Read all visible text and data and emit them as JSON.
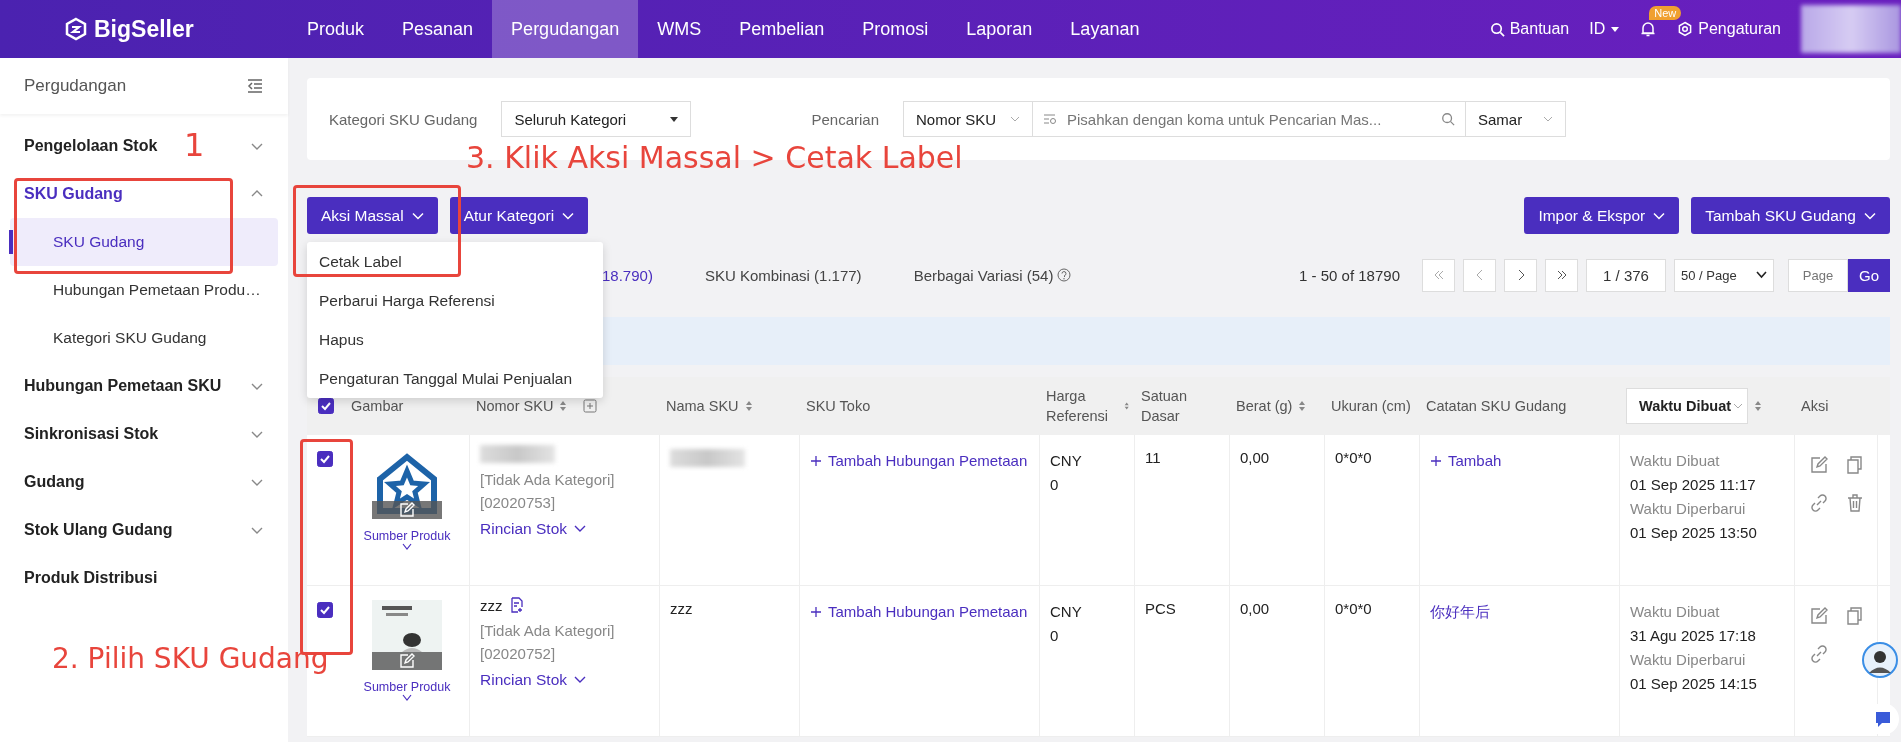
{
  "topbar": {
    "logo": "BigSeller",
    "nav": [
      {
        "label": "Produk",
        "selected": false
      },
      {
        "label": "Pesanan",
        "selected": false
      },
      {
        "label": "Pergudangan",
        "selected": true
      },
      {
        "label": "WMS",
        "selected": false
      },
      {
        "label": "Pembelian",
        "selected": false
      },
      {
        "label": "Promosi",
        "selected": false
      },
      {
        "label": "Laporan",
        "selected": false
      },
      {
        "label": "Layanan",
        "selected": false
      }
    ],
    "help": "Bantuan",
    "language": "ID",
    "badge": "New",
    "settings": "Pengaturan"
  },
  "sidebar": {
    "title": "Pergudangan",
    "items": [
      {
        "label": "Pengelolaan Stok",
        "kind": "group",
        "selected": false,
        "expanded": false
      },
      {
        "label": "SKU Gudang",
        "kind": "group",
        "selected": true,
        "expanded": true,
        "children": [
          {
            "label": "SKU Gudang",
            "selected": true
          },
          {
            "label": "Hubungan Pemetaan Produ…",
            "selected": false
          },
          {
            "label": "Kategori SKU Gudang",
            "selected": false
          }
        ]
      },
      {
        "label": "Hubungan Pemetaan SKU",
        "kind": "group",
        "selected": false,
        "expanded": false
      },
      {
        "label": "Sinkronisasi Stok",
        "kind": "group",
        "selected": false,
        "expanded": false
      },
      {
        "label": "Gudang",
        "kind": "group",
        "selected": false,
        "expanded": false
      },
      {
        "label": "Stok Ulang Gudang",
        "kind": "group",
        "selected": false,
        "expanded": false
      },
      {
        "label": "Produk Distribusi",
        "kind": "link",
        "selected": false
      }
    ]
  },
  "filters": {
    "category_label": "Kategori SKU Gudang",
    "category_value": "Seluruh Kategori",
    "search_label": "Pencarian",
    "search_type": "Nomor SKU",
    "search_placeholder": "Pisahkan dengan koma untuk Pencarian Mas...",
    "match_mode": "Samar"
  },
  "toolbar": {
    "left_buttons": [
      "Aksi Massal",
      "Atur Kategori"
    ],
    "right_buttons": [
      "Impor & Ekspor",
      "Tambah SKU Gudang"
    ]
  },
  "bulk_menu": {
    "items": [
      "Cetak Label",
      "Perbarui Harga Referensi",
      "Hapus",
      "Pengaturan Tanggal Mulai Penjualan"
    ]
  },
  "tabs": [
    {
      "label": "18.790)",
      "selected": true
    },
    {
      "label": "SKU Kombinasi (1.177)",
      "selected": false
    },
    {
      "label": "Berbagai Variasi (54)",
      "selected": false
    }
  ],
  "pagination": {
    "range": "1 - 50 of 18790",
    "page": "1 / 376",
    "page_size": "50 / Page",
    "jump_placeholder": "Page",
    "go": "Go"
  },
  "table": {
    "all_checked": true,
    "columns": [
      "Gambar",
      "Nomor SKU",
      "Nama SKU",
      "SKU Toko",
      "Harga Referensi",
      "Satuan Dasar",
      "Berat (g)",
      "Ukuran (cm)",
      "Catatan SKU Gudang",
      "Waktu Dibuat",
      "Aksi"
    ],
    "rows": [
      {
        "checked": true,
        "source": "Sumber Produk",
        "sku": "",
        "category": "[Tidak Ada Kategori]",
        "code": "[02020753]",
        "stock_link": "Rincian Stok",
        "name": "",
        "store_sku": "Tambah Hubungan Pemetaan",
        "currency": "CNY",
        "price": "0",
        "unit": "11",
        "weight": "0,00",
        "size": "0*0*0",
        "note": {
          "text": "Tambah",
          "kind": "add"
        },
        "created_label": "Waktu Dibuat",
        "created": "01 Sep 2025 11:17",
        "updated_label": "Waktu Diperbarui",
        "updated": "01 Sep 2025 13:50"
      },
      {
        "checked": true,
        "source": "Sumber Produk",
        "sku": "zzz",
        "category": "[Tidak Ada Kategori]",
        "code": "[02020752]",
        "stock_link": "Rincian Stok",
        "name": "zzz",
        "store_sku": "Tambah Hubungan Pemetaan",
        "currency": "CNY",
        "price": "0",
        "unit": "PCS",
        "weight": "0,00",
        "size": "0*0*0",
        "note": {
          "text": "你好年后",
          "kind": "text"
        },
        "created_label": "Waktu Dibuat",
        "created": "31 Agu 2025 17:18",
        "updated_label": "Waktu Diperbarui",
        "updated": "01 Sep 2025 14:15"
      }
    ]
  },
  "annotations": [
    {
      "text": "1",
      "kind": "step-one"
    },
    {
      "text": "2. Pilih SKU Gudang",
      "kind": "step-two"
    },
    {
      "text": "3. Klik Aksi Massal > Cetak Label",
      "kind": "step-three"
    }
  ]
}
